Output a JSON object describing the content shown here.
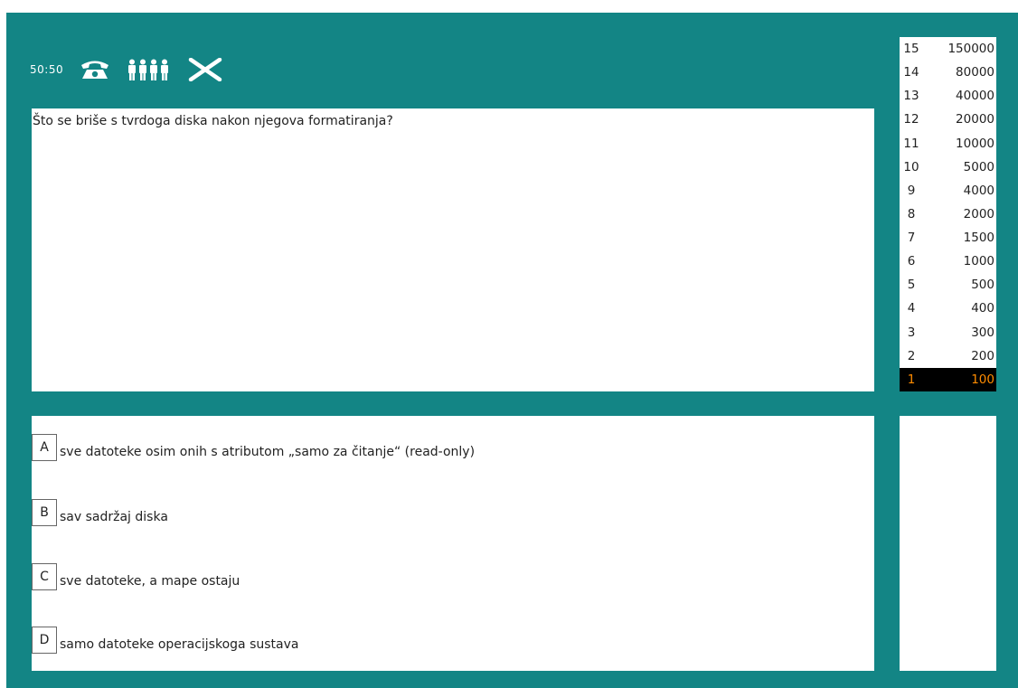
{
  "lifelines": {
    "fifty_label": "50:50",
    "phone_icon": "phone-icon",
    "audience_icon": "audience-icon",
    "quit_icon": "close-icon"
  },
  "question": {
    "text": "Što se briše s tvrdoga diska nakon njegova formatiranja?"
  },
  "answers": [
    {
      "letter": "A",
      "text": "sve datoteke osim onih s atributom „samo za čitanje“ (read-only)"
    },
    {
      "letter": "B",
      "text": "sav sadržaj diska"
    },
    {
      "letter": "C",
      "text": "sve datoteke, a mape ostaju"
    },
    {
      "letter": "D",
      "text": "samo datoteke operacijskoga sustava"
    }
  ],
  "ladder": [
    {
      "level": "15",
      "amount": "150000"
    },
    {
      "level": "14",
      "amount": "80000"
    },
    {
      "level": "13",
      "amount": "40000"
    },
    {
      "level": "12",
      "amount": "20000"
    },
    {
      "level": "11",
      "amount": "10000"
    },
    {
      "level": "10",
      "amount": "5000"
    },
    {
      "level": "9",
      "amount": "4000"
    },
    {
      "level": "8",
      "amount": "2000"
    },
    {
      "level": "7",
      "amount": "1500"
    },
    {
      "level": "6",
      "amount": "1000"
    },
    {
      "level": "5",
      "amount": "500"
    },
    {
      "level": "4",
      "amount": "400"
    },
    {
      "level": "3",
      "amount": "300"
    },
    {
      "level": "2",
      "amount": "200"
    },
    {
      "level": "1",
      "amount": "100"
    }
  ],
  "current_level": "1",
  "colors": {
    "background": "#138585",
    "highlight_bg": "#000000",
    "highlight_text": "#ff8c00"
  }
}
